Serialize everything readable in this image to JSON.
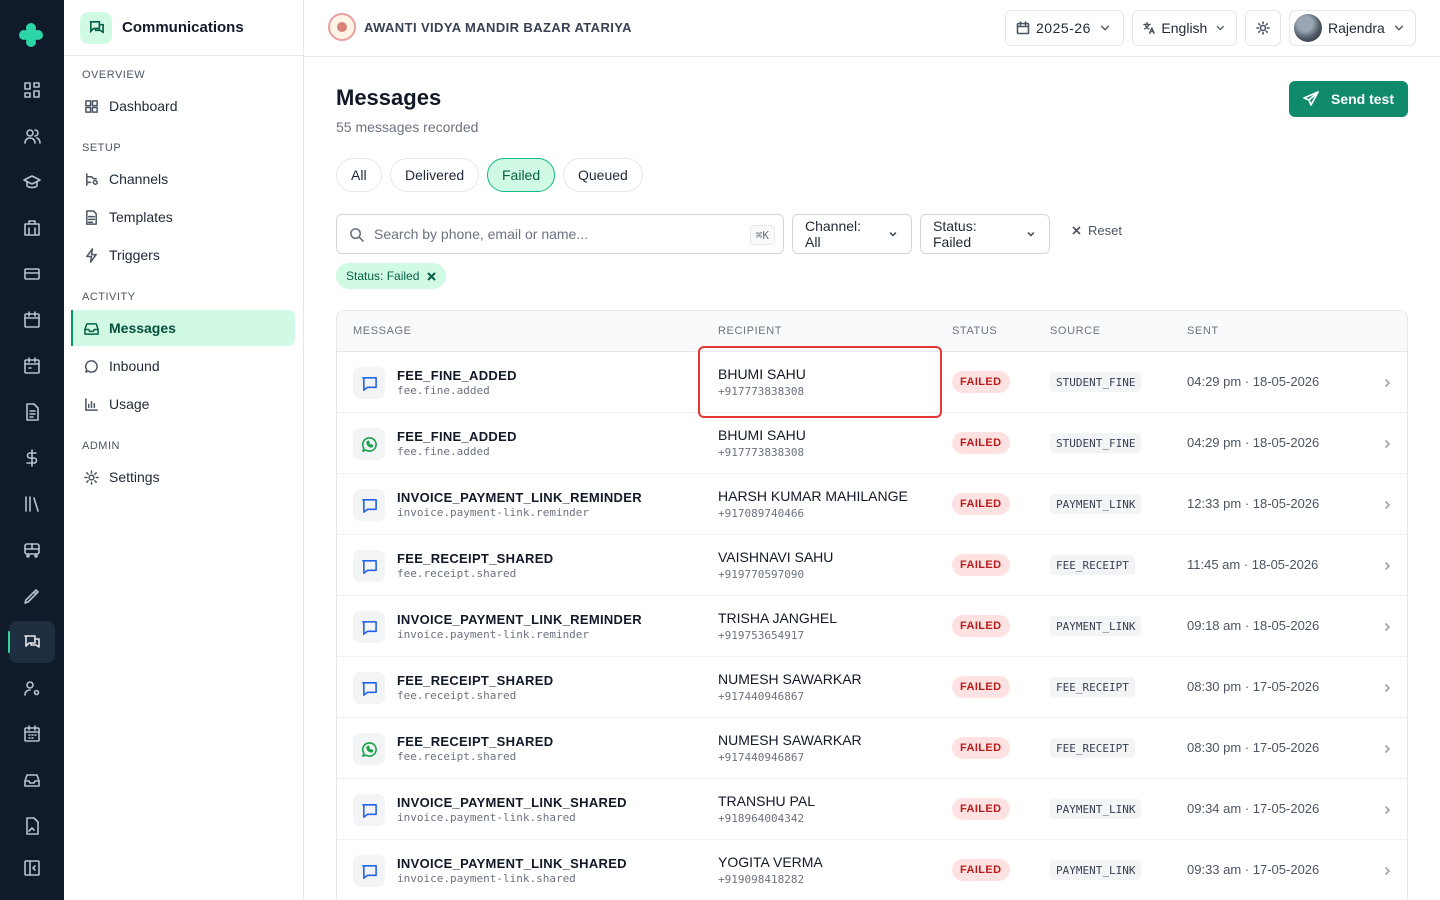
{
  "sidebar": {
    "title": "Communications",
    "sections": [
      {
        "label": "OVERVIEW"
      },
      {
        "label": "SETUP"
      },
      {
        "label": "ACTIVITY"
      },
      {
        "label": "ADMIN"
      }
    ],
    "items": [
      {
        "label": "Dashboard",
        "icon": "dashboard-icon"
      },
      {
        "label": "Channels",
        "icon": "channels-icon"
      },
      {
        "label": "Templates",
        "icon": "file-icon"
      },
      {
        "label": "Triggers",
        "icon": "bolt-icon"
      },
      {
        "label": "Messages",
        "icon": "inbox-icon",
        "active": true
      },
      {
        "label": "Inbound",
        "icon": "chat-bubble-icon"
      },
      {
        "label": "Usage",
        "icon": "bar-chart-icon"
      },
      {
        "label": "Settings",
        "icon": "gear-icon"
      }
    ]
  },
  "topbar": {
    "school_name": "AWANTI VIDYA MANDIR BAZAR ATARIYA",
    "year": "2025-26",
    "language": "English",
    "user": "Rajendra"
  },
  "main": {
    "title": "Messages",
    "subtitle": "55 messages recorded",
    "send_button": "Send test",
    "tabs": [
      {
        "label": "All",
        "active": false
      },
      {
        "label": "Delivered",
        "active": false
      },
      {
        "label": "Failed",
        "active": true
      },
      {
        "label": "Queued",
        "active": false
      }
    ],
    "search": {
      "placeholder": "Search by phone, email or name...",
      "shortcut": "⌘K"
    },
    "channel_filter": "Channel: All",
    "status_filter": "Status: Failed",
    "reset_label": "Reset",
    "active_chip": "Status: Failed",
    "columns": [
      "MESSAGE",
      "RECIPIENT",
      "STATUS",
      "SOURCE",
      "SENT"
    ],
    "rows": [
      {
        "channel": "sms",
        "name": "FEE_FINE_ADDED",
        "code": "fee.fine.added",
        "recipient": "BHUMI SAHU",
        "phone": "+917773838308",
        "status": "FAILED",
        "source": "STUDENT_FINE",
        "sent": "04:29 pm · 18-05-2026"
      },
      {
        "channel": "whatsapp",
        "name": "FEE_FINE_ADDED",
        "code": "fee.fine.added",
        "recipient": "BHUMI SAHU",
        "phone": "+917773838308",
        "status": "FAILED",
        "source": "STUDENT_FINE",
        "sent": "04:29 pm · 18-05-2026"
      },
      {
        "channel": "sms",
        "name": "INVOICE_PAYMENT_LINK_REMINDER",
        "code": "invoice.payment-link.reminder",
        "recipient": "HARSH KUMAR MAHILANGE",
        "phone": "+917089740466",
        "status": "FAILED",
        "source": "PAYMENT_LINK",
        "sent": "12:33 pm · 18-05-2026"
      },
      {
        "channel": "sms",
        "name": "FEE_RECEIPT_SHARED",
        "code": "fee.receipt.shared",
        "recipient": "VAISHNAVI SAHU",
        "phone": "+919770597090",
        "status": "FAILED",
        "source": "FEE_RECEIPT",
        "sent": "11:45 am · 18-05-2026"
      },
      {
        "channel": "sms",
        "name": "INVOICE_PAYMENT_LINK_REMINDER",
        "code": "invoice.payment-link.reminder",
        "recipient": "TRISHA JANGHEL",
        "phone": "+919753654917",
        "status": "FAILED",
        "source": "PAYMENT_LINK",
        "sent": "09:18 am · 18-05-2026"
      },
      {
        "channel": "sms",
        "name": "FEE_RECEIPT_SHARED",
        "code": "fee.receipt.shared",
        "recipient": "NUMESH SAWARKAR",
        "phone": "+917440946867",
        "status": "FAILED",
        "source": "FEE_RECEIPT",
        "sent": "08:30 pm · 17-05-2026"
      },
      {
        "channel": "whatsapp",
        "name": "FEE_RECEIPT_SHARED",
        "code": "fee.receipt.shared",
        "recipient": "NUMESH SAWARKAR",
        "phone": "+917440946867",
        "status": "FAILED",
        "source": "FEE_RECEIPT",
        "sent": "08:30 pm · 17-05-2026"
      },
      {
        "channel": "sms",
        "name": "INVOICE_PAYMENT_LINK_SHARED",
        "code": "invoice.payment-link.shared",
        "recipient": "TRANSHU PAL",
        "phone": "+918964004342",
        "status": "FAILED",
        "source": "PAYMENT_LINK",
        "sent": "09:34 am · 17-05-2026"
      },
      {
        "channel": "sms",
        "name": "INVOICE_PAYMENT_LINK_SHARED",
        "code": "invoice.payment-link.shared",
        "recipient": "YOGITA VERMA",
        "phone": "+919098418282",
        "status": "FAILED",
        "source": "PAYMENT_LINK",
        "sent": "09:33 am · 17-05-2026"
      }
    ]
  },
  "colors": {
    "accent": "#0f8a6a",
    "rail_bg": "#0f1b2a",
    "failed_bg": "#fee2e2",
    "failed_text": "#b91c1c",
    "highlight": "#e53935",
    "sms_icon": "#2563eb",
    "whatsapp_icon": "#16a34a"
  }
}
